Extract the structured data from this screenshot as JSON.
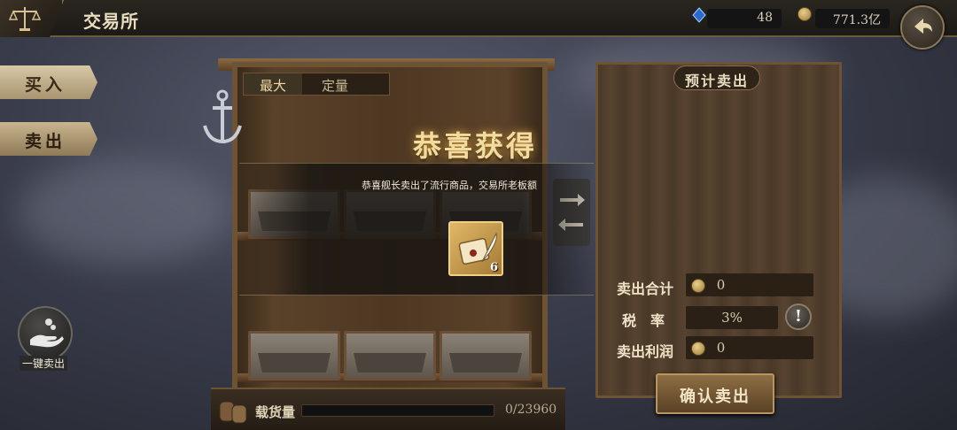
{
  "header": {
    "title": "交易所",
    "gems": "48",
    "coins": "771.3亿"
  },
  "sidebar": {
    "tabs": [
      {
        "label": "买入",
        "active": false
      },
      {
        "label": "卖出",
        "active": true
      }
    ],
    "onekey_label": "一键卖出"
  },
  "shelf": {
    "modes": [
      "最大",
      "定量"
    ],
    "active_mode": "最大"
  },
  "reward": {
    "title": "恭喜获得",
    "message": "恭喜舰长卖出了流行商品，交易所老板额",
    "item_count": "6",
    "item_icon": "scroll-quill-icon"
  },
  "cargo": {
    "label": "载货量",
    "value": "0/23960",
    "fill_fraction": 0
  },
  "sell_panel": {
    "title": "预计卖出",
    "total_label": "卖出合计",
    "total_value": "0",
    "tax_label": "税　率",
    "tax_value": "3%",
    "profit_label": "卖出利润",
    "profit_value": "0",
    "warn_symbol": "!",
    "confirm_label": "确认卖出"
  },
  "colors": {
    "accent_gold": "#f3dca0",
    "wood_dark": "#4a3828",
    "panel_border": "#6e5234"
  }
}
